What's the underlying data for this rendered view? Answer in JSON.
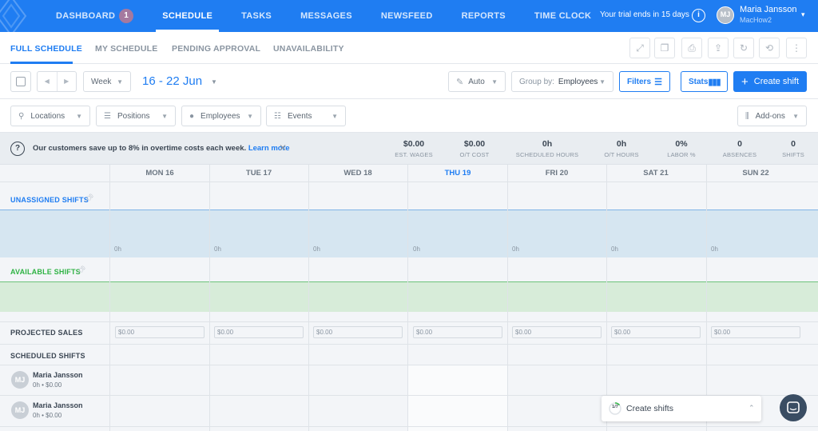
{
  "nav": {
    "items": [
      {
        "label": "DASHBOARD",
        "badge": "1"
      },
      {
        "label": "SCHEDULE"
      },
      {
        "label": "TASKS"
      },
      {
        "label": "MESSAGES"
      },
      {
        "label": "NEWSFEED"
      },
      {
        "label": "REPORTS"
      },
      {
        "label": "TIME CLOCK"
      }
    ],
    "trial_text": "Your trial ends in 15 days",
    "info_glyph": "i",
    "user": {
      "initials": "MJ",
      "name": "Maria Jansson",
      "sub": "MacHow2"
    }
  },
  "subtabs": [
    "FULL SCHEDULE",
    "MY SCHEDULE",
    "PENDING APPROVAL",
    "UNAVAILABILITY"
  ],
  "toolbar": {
    "view": "Week",
    "date_range": "16 - 22 Jun",
    "auto": "Auto",
    "group_by_label": "Group by:",
    "group_by_value": "Employees",
    "filters": "Filters",
    "stats": "Stats",
    "create_shift": "Create shift"
  },
  "filters": {
    "locations": "Locations",
    "positions": "Positions",
    "employees": "Employees",
    "events": "Events",
    "addons": "Add-ons"
  },
  "infobar": {
    "message": "Our customers save up to 8% in overtime costs each week.",
    "link": "Learn more",
    "stats": [
      {
        "value": "$0.00",
        "label": "EST. WAGES"
      },
      {
        "value": "$0.00",
        "label": "O/T COST"
      },
      {
        "value": "0h",
        "label": "SCHEDULED HOURS"
      },
      {
        "value": "0h",
        "label": "O/T HOURS"
      },
      {
        "value": "0%",
        "label": "LABOR %"
      },
      {
        "value": "0",
        "label": "ABSENCES"
      },
      {
        "value": "0",
        "label": "SHIFTS"
      }
    ]
  },
  "days": [
    "MON 16",
    "TUE 17",
    "WED 18",
    "THU 19",
    "FRI 20",
    "SAT 21",
    "SUN 22"
  ],
  "today_index": 3,
  "sections": {
    "unassigned": "UNASSIGNED SHIFTS",
    "available": "AVAILABLE SHIFTS",
    "projected_sales": "PROJECTED SALES",
    "scheduled": "SCHEDULED SHIFTS"
  },
  "unassigned_hours": [
    "0h",
    "0h",
    "0h",
    "0h",
    "0h",
    "0h",
    "0h"
  ],
  "projected_sales": [
    "$0.00",
    "$0.00",
    "$0.00",
    "$0.00",
    "$0.00",
    "$0.00",
    "$0.00"
  ],
  "employees": [
    {
      "initials": "MJ",
      "name": "Maria Jansson",
      "sub": "0h • $0.00"
    },
    {
      "initials": "MJ",
      "name": "Maria Jansson",
      "sub": "0h • $0.00"
    }
  ],
  "create_shifts_popup": {
    "progress": "1/7",
    "label": "Create shifts"
  },
  "colors": {
    "accent": "#1f7df2",
    "unassigned": "#d6e6f1",
    "available": "#d7ecd9",
    "available_text": "#2fb344"
  }
}
